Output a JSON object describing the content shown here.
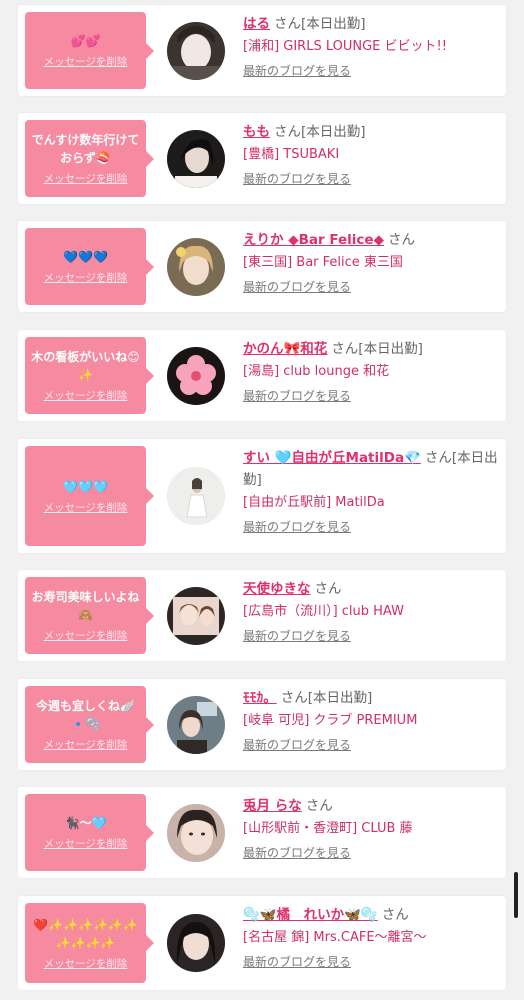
{
  "cards": [
    {
      "message": "💕💕",
      "delete_label": "メッセージを削除",
      "name": "はる",
      "suffix": "さん[本日出勤]",
      "shop": "[浦和] GIRLS LOUNGE ビビット!!",
      "blog_label": "最新のブログを見る",
      "avatar_icon": "portrait-face-photo"
    },
    {
      "message": "でんすけ数年行けておらず🍣",
      "delete_label": "メッセージを削除",
      "name": "もも",
      "suffix": "さん[本日出勤]",
      "shop": "[豊橋] TSUBAKI",
      "blog_label": "最新のブログを見る",
      "avatar_icon": "portrait-dark-photo"
    },
    {
      "message": "💙💙💙",
      "delete_label": "メッセージを削除",
      "name": "えりか ◆Bar Felice◆",
      "suffix": "さん",
      "shop": "[東三国] Bar Felice 東三国",
      "blog_label": "最新のブログを見る",
      "avatar_icon": "portrait-blonde-photo"
    },
    {
      "message": "木の看板がいいね😊✨",
      "delete_label": "メッセージを削除",
      "name": "かのん🎀和花",
      "suffix": "さん[本日出勤]",
      "shop": "[湯島] club lounge 和花",
      "blog_label": "最新のブログを見る",
      "avatar_icon": "pink-flower-icon"
    },
    {
      "message": "🩵🩵🩵",
      "delete_label": "メッセージを削除",
      "name": "すい 🩵自由が丘MatilDa💎",
      "suffix": "さん[本日出勤]",
      "shop": "[自由が丘駅前] MatilDa",
      "blog_label": "最新のブログを見る",
      "avatar_icon": "portrait-white-dress-photo"
    },
    {
      "message": "お寿司美味しいよね🙈",
      "delete_label": "メッセージを削除",
      "name": "天使ゆきな",
      "suffix": "さん",
      "shop": "[広島市（流川）] club HAW",
      "blog_label": "最新のブログを見る",
      "avatar_icon": "portrait-collage-photo"
    },
    {
      "message": "今週も宜しくね🪽🔹🫧",
      "delete_label": "メッセージを削除",
      "name": "ﾓﾓｶ。",
      "suffix": "さん[本日出勤]",
      "shop": "[岐阜 可児] クラブ PREMIUM",
      "blog_label": "最新のブログを見る",
      "avatar_icon": "portrait-street-photo"
    },
    {
      "message": "🐈‍⬛〜🩵",
      "delete_label": "メッセージを削除",
      "name": "兎月 らな",
      "suffix": "さん",
      "shop": "[山形駅前・香澄町] CLUB 藤",
      "blog_label": "最新のブログを見る",
      "avatar_icon": "portrait-closeup-photo"
    },
    {
      "message": "❤️✨✨✨✨✨✨✨✨✨✨",
      "delete_label": "メッセージを削除",
      "name": "🫧🦋橘　れいか🦋🫧",
      "suffix": "さん",
      "shop": "[名古屋 錦] Mrs.CAFE〜離宮〜",
      "blog_label": "最新のブログを見る",
      "avatar_icon": "portrait-dark-hair-photo"
    }
  ],
  "colors": {
    "bubble": "#f58aa1",
    "name": "#e1306c",
    "shop": "#d12d6a",
    "background": "#f1f1f1"
  }
}
